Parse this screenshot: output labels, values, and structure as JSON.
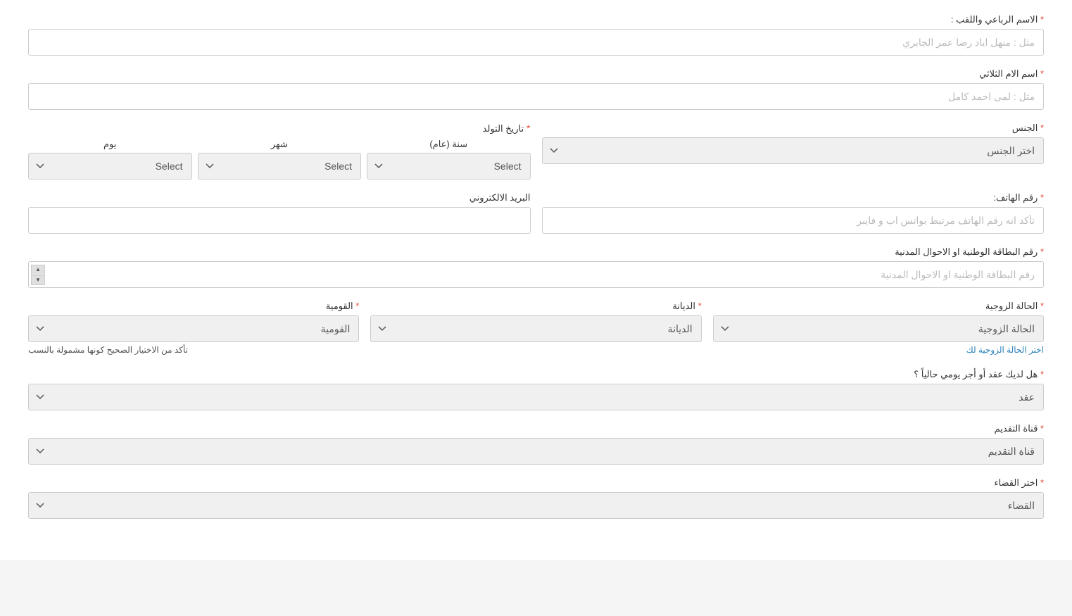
{
  "form": {
    "full_name": {
      "label": "الاسم الرباعي واللقب :",
      "required": true,
      "placeholder": "مثل : منهل اياد رضا عمر الجابري"
    },
    "mother_name": {
      "label": "اسم الام الثلاثي",
      "required": true,
      "placeholder": "مثل : لمى احمد كامل"
    },
    "birth_date": {
      "label": "تاريخ التولد",
      "required": true,
      "year_label": "سنة (عام)",
      "month_label": "شهر",
      "day_label": "يوم",
      "year_placeholder": "Select",
      "month_placeholder": "Select",
      "day_placeholder": "Select"
    },
    "gender": {
      "label": "الجنس",
      "required": true,
      "placeholder": "اختر الجنس"
    },
    "phone": {
      "label": "رقم الهاتف:",
      "required": true,
      "placeholder": "تأكد انه رقم الهاتف مرتبط بواتس اب و فايبر"
    },
    "email": {
      "label": "البريد الالكتروني",
      "required": false,
      "placeholder": ""
    },
    "national_id": {
      "label": "رقم البطاقة الوطنية او الاحوال المدنية",
      "required": true,
      "placeholder": "رقم البطاقة الوطنية او الاحوال المدنية"
    },
    "nationality": {
      "label": "القومية",
      "required": true,
      "placeholder": "القومية"
    },
    "religion": {
      "label": "الديانة",
      "required": true,
      "placeholder": "الديانة"
    },
    "marital_status": {
      "label": "الحالة الزوجية",
      "required": true,
      "placeholder": "الحالة الزوجية"
    },
    "marital_hint": "تأكد من الاختيار الصحيح كونها مشمولة بالنسب",
    "marital_link": "اختر الحالة الزوجية لك",
    "contract": {
      "label": "هل لديك عقد أو أجر يومي حالياً ؟",
      "required": true,
      "placeholder": "عقد"
    },
    "submission_channel": {
      "label": "قناة التقديم",
      "required": true,
      "placeholder": "قناة التقديم"
    },
    "judiciary": {
      "label": "اختر القضاء",
      "required": true,
      "placeholder": "القضاء"
    }
  }
}
